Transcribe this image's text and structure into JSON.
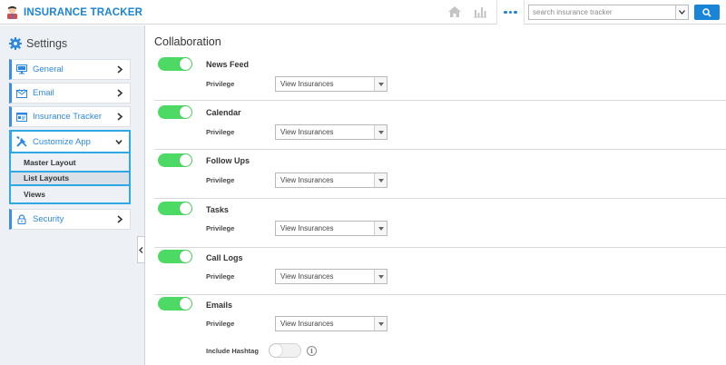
{
  "app": {
    "title": "INSURANCE TRACKER"
  },
  "topbar": {
    "home_icon": "home-icon",
    "chart_icon": "bar-chart-icon",
    "more_icon": "more-dots-icon",
    "search": {
      "placeholder": "search insurance tracker",
      "value": ""
    },
    "search_icon": "search-icon"
  },
  "colors": {
    "brand": "#1a84d6",
    "toggle_on": "#4cd964",
    "active_border": "#2ea9e6"
  },
  "sidebar": {
    "heading": "Settings",
    "items": [
      {
        "label": "General",
        "icon": "monitor-icon"
      },
      {
        "label": "Email",
        "icon": "envelope-icon"
      },
      {
        "label": "Insurance Tracker",
        "icon": "id-card-icon"
      },
      {
        "label": "Customize App",
        "icon": "tools-icon"
      },
      {
        "label": "Security",
        "icon": "lock-icon"
      }
    ],
    "sub_items": [
      {
        "label": "Master Layout"
      },
      {
        "label": "List Layouts"
      },
      {
        "label": "Views"
      }
    ]
  },
  "main": {
    "title": "Collaboration",
    "privilege_label": "Privilege",
    "features": [
      {
        "name": "News Feed",
        "enabled": true,
        "privilege": "View Insurances"
      },
      {
        "name": "Calendar",
        "enabled": true,
        "privilege": "View Insurances"
      },
      {
        "name": "Follow Ups",
        "enabled": true,
        "privilege": "View Insurances"
      },
      {
        "name": "Tasks",
        "enabled": true,
        "privilege": "View Insurances"
      },
      {
        "name": "Call Logs",
        "enabled": true,
        "privilege": "View Insurances"
      },
      {
        "name": "Emails",
        "enabled": true,
        "privilege": "View Insurances"
      }
    ],
    "hashtag": {
      "label": "Include Hashtag",
      "enabled": false,
      "info_glyph": "i"
    }
  }
}
